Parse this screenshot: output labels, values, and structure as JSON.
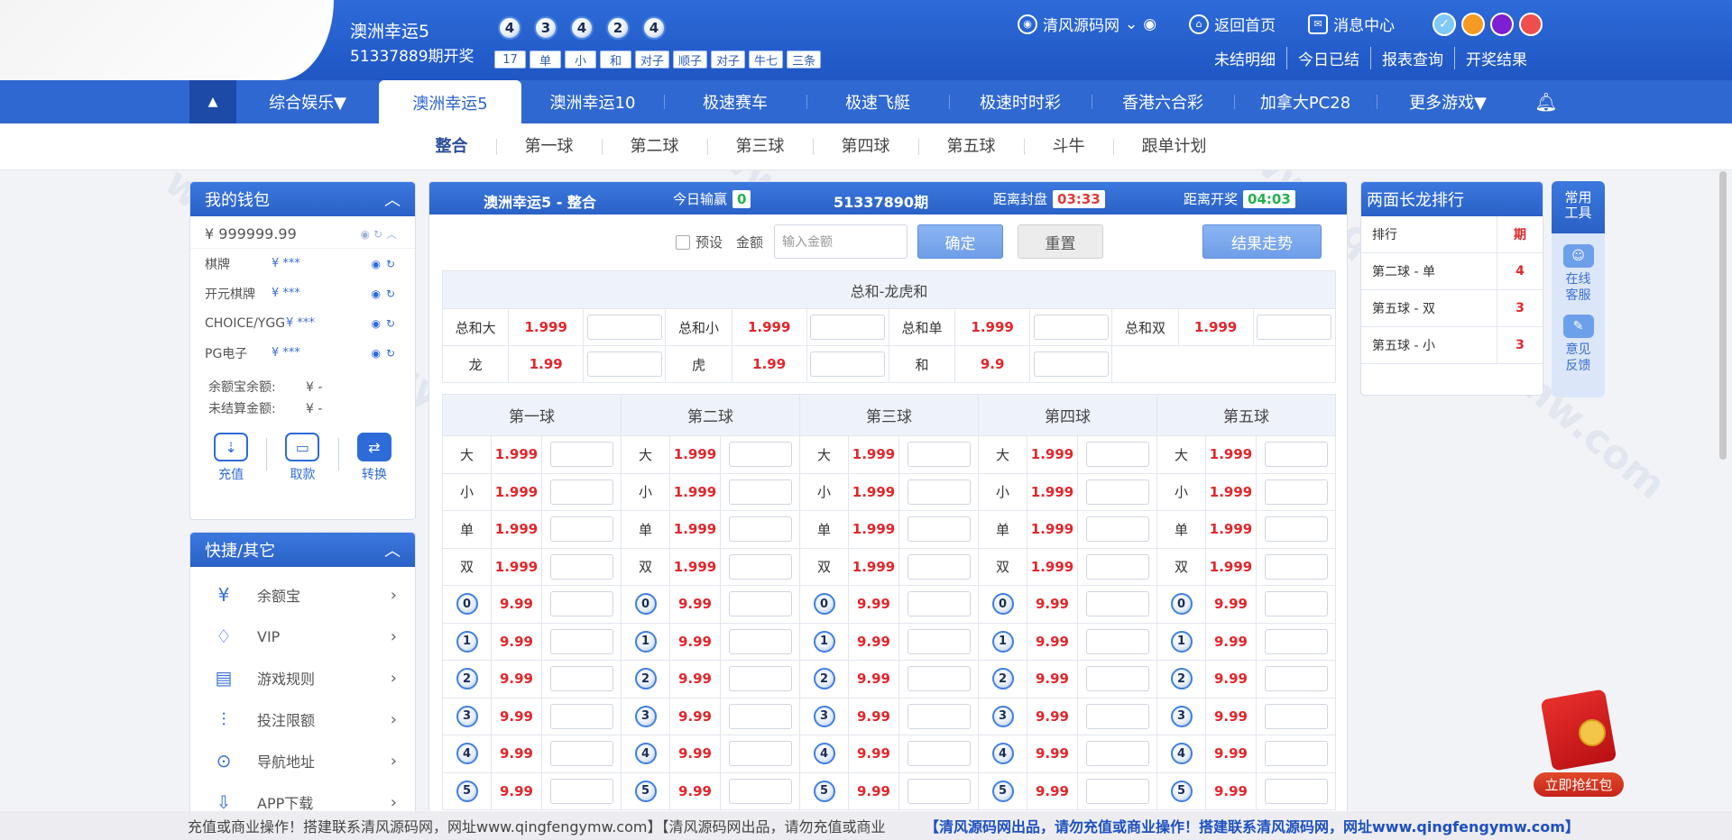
{
  "header": {
    "game_title": "澳洲幸运5",
    "period_text": "51337889期开奖",
    "balls": [
      "4",
      "3",
      "4",
      "2",
      "4"
    ],
    "tags": [
      "17",
      "单",
      "小",
      "和",
      "对子",
      "顺子",
      "对子",
      "牛七",
      "三条"
    ],
    "account": "清风源码网",
    "home": "返回首页",
    "messages": "消息中心",
    "links": [
      "未结明细",
      "今日已结",
      "报表查询",
      "开奖结果"
    ],
    "theme_colors": [
      "#7fc8f8",
      "#f59a23",
      "#7d1fd2",
      "#f04e4e"
    ]
  },
  "nav": {
    "tabs": [
      "综合娱乐▼",
      "澳洲幸运5",
      "澳洲幸运10",
      "极速赛车",
      "极速飞艇",
      "极速时时彩",
      "香港六合彩",
      "加拿大PC28",
      "更多游戏▼"
    ]
  },
  "subnav": [
    "整合",
    "第一球",
    "第二球",
    "第三球",
    "第四球",
    "第五球",
    "斗牛",
    "跟单计划"
  ],
  "wallet": {
    "title": "我的钱包",
    "total": "¥ 999999.99",
    "rows": [
      {
        "name": "棋牌",
        "amount": "¥ ***"
      },
      {
        "name": "开元棋牌",
        "amount": "¥ ***"
      },
      {
        "name": "CHOICE/YGG",
        "amount": "¥ ***"
      },
      {
        "name": "PG电子",
        "amount": "¥ ***"
      }
    ],
    "yuebao_label": "余额宝余额:",
    "yuebao_value": "¥ -",
    "unsettled_label": "未结算金额:",
    "unsettled_value": "¥ -",
    "actions": [
      "充值",
      "取款",
      "转换"
    ]
  },
  "quick": {
    "title": "快捷/其它",
    "items": [
      "余额宝",
      "VIP",
      "游戏规则",
      "投注限额",
      "导航地址",
      "APP下载"
    ]
  },
  "main": {
    "title": "澳洲幸运5 - 整合",
    "today_label": "今日输赢",
    "today_value": "0",
    "period": "51337890期",
    "close_label": "距离封盘",
    "close_time": "03:33",
    "draw_label": "距离开奖",
    "draw_time": "04:03",
    "preset": "预设",
    "amount_label": "金额",
    "amount_placeholder": "输入金额",
    "confirm": "确定",
    "reset": "重置",
    "trend": "结果走势",
    "sum_caption": "总和-龙虎和",
    "sum_row1": [
      {
        "label": "总和大",
        "odds": "1.999"
      },
      {
        "label": "总和小",
        "odds": "1.999"
      },
      {
        "label": "总和单",
        "odds": "1.999"
      },
      {
        "label": "总和双",
        "odds": "1.999"
      }
    ],
    "sum_row2": [
      {
        "label": "龙",
        "odds": "1.99"
      },
      {
        "label": "虎",
        "odds": "1.99"
      },
      {
        "label": "和",
        "odds": "9.9"
      }
    ],
    "ball_headers": [
      "第一球",
      "第二球",
      "第三球",
      "第四球",
      "第五球"
    ],
    "text_rows": [
      {
        "label": "大",
        "odds": "1.999"
      },
      {
        "label": "小",
        "odds": "1.999"
      },
      {
        "label": "单",
        "odds": "1.999"
      },
      {
        "label": "双",
        "odds": "1.999"
      }
    ],
    "number_rows": [
      {
        "label": "0",
        "odds": "9.99"
      },
      {
        "label": "1",
        "odds": "9.99"
      },
      {
        "label": "2",
        "odds": "9.99"
      },
      {
        "label": "3",
        "odds": "9.99"
      },
      {
        "label": "4",
        "odds": "9.99"
      },
      {
        "label": "5",
        "odds": "9.99"
      }
    ]
  },
  "rank": {
    "title": "两面长龙排行",
    "col_name": "排行",
    "col_value": "期",
    "rows": [
      {
        "name": "第二球 - 单",
        "value": "4"
      },
      {
        "name": "第五球 - 双",
        "value": "3"
      },
      {
        "name": "第五球 - 小",
        "value": "3"
      }
    ]
  },
  "tools": {
    "title": "常用工具",
    "items": [
      "在线客服",
      "意见反馈"
    ]
  },
  "redpacket": "立即抢红包",
  "marquee": {
    "left": "充值或商业操作！搭建联系清风源码网，网址www.qingfengymw.com】【清风源码网出品，请勿充值或商业",
    "right": "【清风源码网出品，请勿充值或商业操作！搭建联系清风源码网，网址www.qingfengymw.com】"
  },
  "watermark": "www.qingfengymw.com"
}
